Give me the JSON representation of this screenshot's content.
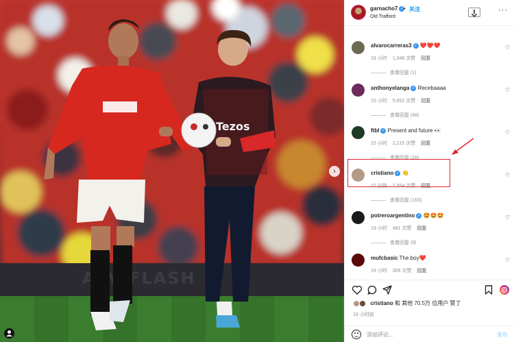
{
  "photo": {
    "alt": "",
    "next_glyph": "›",
    "tag_glyph": "●",
    "board_text": "ATV   FLASH"
  },
  "header": {
    "username": "garnacho7",
    "dot": "•",
    "follow_label": "关注",
    "location": "Old Trafford",
    "more_glyph": "···"
  },
  "comments": [
    {
      "user": "alvarocarreras3",
      "verified": true,
      "text": "❤️❤️❤️",
      "time": "18 小时",
      "likes": "1,048 次赞",
      "reply": "回复",
      "view_replies": "查看回复 (1)",
      "avatar_color": "#6b6b52"
    },
    {
      "user": "anthonyelanga",
      "verified": true,
      "text": "Recebaaaa",
      "time": "15 小时",
      "likes": "5,852 次赞",
      "reply": "回复",
      "view_replies": "查看回复 (48)",
      "avatar_color": "#6d2a5a"
    },
    {
      "user": "ftbl",
      "verified": true,
      "text": "Present and future 👀",
      "time": "15 小时",
      "likes": "2,215 次赞",
      "reply": "回复",
      "view_replies": "查看回复 (16)",
      "avatar_color": "#1d3a24"
    },
    {
      "user": "cristiano",
      "verified": true,
      "text": "👏",
      "time": "32 分钟",
      "likes": "2,954 次赞",
      "reply": "回复",
      "view_replies": "查看回复 (163)",
      "avatar_color": "#b59a86"
    },
    {
      "user": "potreroargentino",
      "verified": true,
      "text": "🤩🤩🤩",
      "time": "19 小时",
      "likes": "481 次赞",
      "reply": "回复",
      "view_replies": "查看回复 (9)",
      "avatar_color": "#1a1a1a"
    },
    {
      "user": "mufcbasic",
      "verified": false,
      "text": "The boy❤️",
      "time": "19 小时",
      "likes": "359 次赞",
      "reply": "回复",
      "view_replies": "",
      "avatar_color": "#5a0a0a"
    }
  ],
  "actions": {
    "likes_user": "cristiano",
    "likes_rest": " 和 其他 70.5万 位用户 赞了",
    "time_ago": "19 小时前",
    "comment_placeholder": "添加评论...",
    "post_label": "发布"
  },
  "colors": {
    "accent": "#0095f6",
    "highlight": "#e0252f",
    "verified": "#3897f0"
  }
}
